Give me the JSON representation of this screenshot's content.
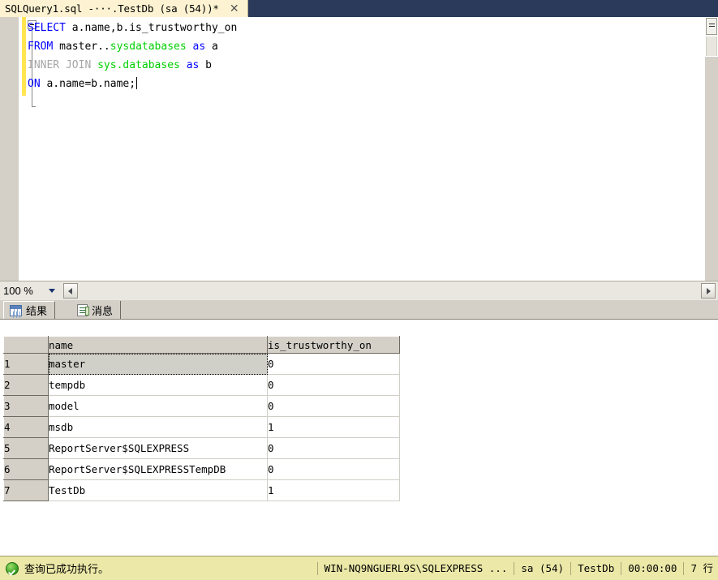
{
  "tab": {
    "title": "SQLQuery1.sql -···.TestDb (sa (54))*",
    "close_label": "✕"
  },
  "editor": {
    "lines": [
      {
        "tokens": [
          {
            "text": "SELECT",
            "style": "kw"
          },
          {
            "text": " a.name,b.is_trustworthy_on",
            "style": "idn"
          }
        ]
      },
      {
        "tokens": [
          {
            "text": "FROM",
            "style": "kw"
          },
          {
            "text": " master..",
            "style": "idn"
          },
          {
            "text": "sysdatabases",
            "style": "grn"
          },
          {
            "text": " ",
            "style": "idn"
          },
          {
            "text": "as",
            "style": "kw"
          },
          {
            "text": " a",
            "style": "idn"
          }
        ]
      },
      {
        "tokens": [
          {
            "text": "INNER JOIN",
            "style": "gray"
          },
          {
            "text": " ",
            "style": "idn"
          },
          {
            "text": "sys.databases",
            "style": "grn"
          },
          {
            "text": " ",
            "style": "idn"
          },
          {
            "text": "as",
            "style": "kw"
          },
          {
            "text": " b",
            "style": "idn"
          }
        ]
      },
      {
        "tokens": [
          {
            "text": "ON",
            "style": "kw"
          },
          {
            "text": " a.name=b.name;",
            "style": "idn"
          }
        ]
      }
    ]
  },
  "zoom_strip": {
    "zoom_level": "100 %"
  },
  "results_tabs": [
    {
      "label": "结果",
      "icon": "results-grid-icon",
      "active": true
    },
    {
      "label": "消息",
      "icon": "messages-icon",
      "active": false
    }
  ],
  "grid": {
    "columns": [
      "",
      "name",
      "is_trustworthy_on"
    ],
    "rows": [
      {
        "num": "1",
        "name": "master",
        "is_trustworthy_on": "0",
        "selected": true
      },
      {
        "num": "2",
        "name": "tempdb",
        "is_trustworthy_on": "0",
        "selected": false
      },
      {
        "num": "3",
        "name": "model",
        "is_trustworthy_on": "0",
        "selected": false
      },
      {
        "num": "4",
        "name": "msdb",
        "is_trustworthy_on": "1",
        "selected": false
      },
      {
        "num": "5",
        "name": "ReportServer$SQLEXPRESS",
        "is_trustworthy_on": "0",
        "selected": false
      },
      {
        "num": "6",
        "name": "ReportServer$SQLEXPRESSTempDB",
        "is_trustworthy_on": "0",
        "selected": false
      },
      {
        "num": "7",
        "name": "TestDb",
        "is_trustworthy_on": "1",
        "selected": false
      }
    ]
  },
  "statusbar": {
    "status_text": "查询已成功执行。",
    "server": "WIN-NQ9NGUERL9S\\SQLEXPRESS ...",
    "user": "sa (54)",
    "database": "TestDb",
    "elapsed": "00:00:00",
    "rowcount": "7 行"
  },
  "colors": {
    "tab_active_bg": "#fdf3d2",
    "tabstrip_bg": "#2b3a5b",
    "keyword": "#0000ff",
    "identifier_green": "#00d000",
    "comment_gray": "#a6a6a6",
    "statusbar_bg": "#ece9a8",
    "chrome_gray": "#d4d0c8",
    "change_bar": "#ffe650",
    "success_green": "#2f9b1e"
  }
}
